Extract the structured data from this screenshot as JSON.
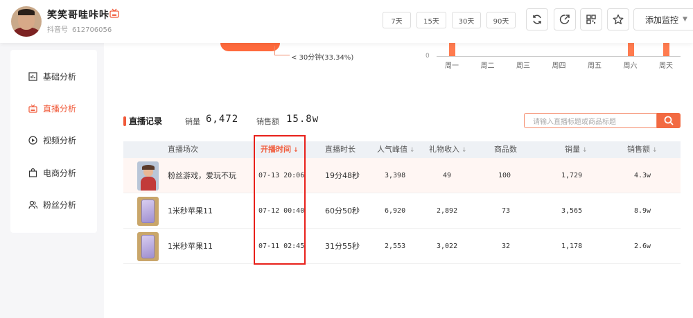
{
  "header": {
    "username": "笑笑哥哇咔咔",
    "douyin_label": "抖音号",
    "douyin_id": "612706056",
    "day_buttons": [
      "7天",
      "15天",
      "30天",
      "90天"
    ],
    "icons": [
      "refresh-icon",
      "share-icon",
      "qrcode-icon",
      "star-icon"
    ],
    "monitor_label": "添加监控"
  },
  "sidebar": {
    "items": [
      {
        "label": "基础分析",
        "icon": "bar-chart-icon"
      },
      {
        "label": "直播分析",
        "icon": "live-tv-icon",
        "active": true
      },
      {
        "label": "视频分析",
        "icon": "play-circle-icon"
      },
      {
        "label": "电商分析",
        "icon": "shopping-bag-icon"
      },
      {
        "label": "粉丝分析",
        "icon": "user-group-icon"
      }
    ]
  },
  "top_charts": {
    "donut_label": "< 30分钟(33.34%)",
    "bar_zero": "0",
    "weekdays": [
      "周一",
      "周二",
      "周三",
      "周四",
      "周五",
      "周六",
      "周天"
    ],
    "bar_days": [
      "周一",
      "周六",
      "周天"
    ]
  },
  "live_records": {
    "title": "直播记录",
    "sales_qty_label": "销量",
    "sales_qty": "6,472",
    "sales_amount_label": "销售额",
    "sales_amount": "15.8w",
    "search_placeholder": "请输入直播标题或商品标题",
    "columns": [
      "直播场次",
      "开播时间",
      "直播时长",
      "人气峰值",
      "礼物收入",
      "商品数",
      "销量",
      "销售额"
    ],
    "sort_arrow": "↓",
    "active_column": "开播时间",
    "rows": [
      {
        "title": "粉丝游戏，爱玩不玩",
        "start": "07-13 20:06",
        "duration": "19分48秒",
        "peak": "3,398",
        "gift": "49",
        "products": "100",
        "sales": "1,729",
        "amount": "4.3w",
        "thumb": "kid"
      },
      {
        "title": "1米秒苹果11",
        "start": "07-12 00:40",
        "duration": "60分50秒",
        "peak": "6,920",
        "gift": "2,892",
        "products": "73",
        "sales": "3,565",
        "amount": "8.9w",
        "thumb": "phone"
      },
      {
        "title": "1米秒苹果11",
        "start": "07-11 02:45",
        "duration": "31分55秒",
        "peak": "2,553",
        "gift": "3,022",
        "products": "32",
        "sales": "1,178",
        "amount": "2.6w",
        "thumb": "phone"
      }
    ]
  }
}
